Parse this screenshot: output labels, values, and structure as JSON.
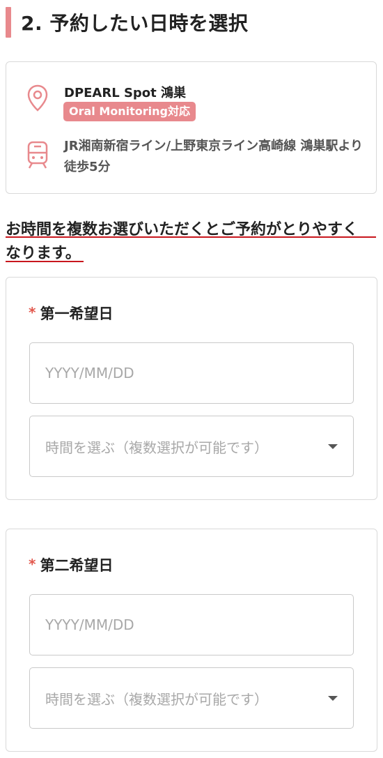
{
  "section": {
    "title": "2. 予約したい日時を選択"
  },
  "store": {
    "name": "DPEARL Spot 鴻巣",
    "badge": "Oral Monitoring対応",
    "access": "JR湘南新宿ライン/上野東京ライン高崎線 鴻巣駅より徒歩5分",
    "location_icon": "location-pin-icon",
    "train_icon": "train-icon",
    "accent_color": "#e8898d"
  },
  "notice": {
    "line1": "お時間を複数お選びいただくとご予約がとりやすく",
    "line2": "なります。",
    "underline_color": "#c8161d"
  },
  "preferences": [
    {
      "label": "第一希望日",
      "required_mark": "*",
      "date_placeholder": "YYYY/MM/DD",
      "time_placeholder": "時間を選ぶ（複数選択が可能です）"
    },
    {
      "label": "第二希望日",
      "required_mark": "*",
      "date_placeholder": "YYYY/MM/DD",
      "time_placeholder": "時間を選ぶ（複数選択が可能です）"
    }
  ]
}
